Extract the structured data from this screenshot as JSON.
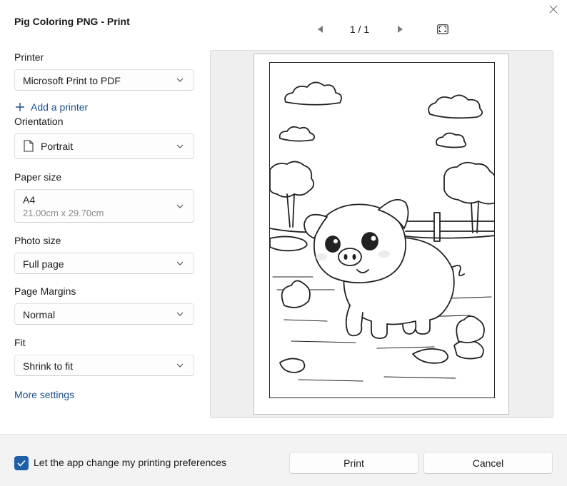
{
  "window": {
    "title": "Pig Coloring PNG - Print"
  },
  "icons": {
    "close": "close-icon",
    "prev": "previous-page-icon",
    "next": "next-page-icon",
    "fit": "fit-to-window-icon",
    "chevron": "chevron-down-icon",
    "orientation": "page-portrait-icon",
    "add": "plus-icon",
    "check": "checkmark-icon"
  },
  "nav": {
    "page_counter": "1 / 1"
  },
  "settings": {
    "printer": {
      "label": "Printer",
      "value": "Microsoft Print to PDF"
    },
    "add_printer": "Add a printer",
    "orientation": {
      "label": "Orientation",
      "value": "Portrait"
    },
    "paper_size": {
      "label": "Paper size",
      "value": "A4",
      "detail": "21.00cm x 29.70cm"
    },
    "photo_size": {
      "label": "Photo size",
      "value": "Full page"
    },
    "page_margins": {
      "label": "Page Margins",
      "value": "Normal"
    },
    "fit": {
      "label": "Fit",
      "value": "Shrink to fit"
    },
    "more_settings": "More settings"
  },
  "footer": {
    "preferences_checked": true,
    "preferences_label": "Let the app change my printing preferences",
    "print_button": "Print",
    "cancel_button": "Cancel"
  },
  "colors": {
    "accent": "#1d5fa8",
    "link": "#1b4f8c",
    "footer_bg": "#f3f3f3"
  }
}
